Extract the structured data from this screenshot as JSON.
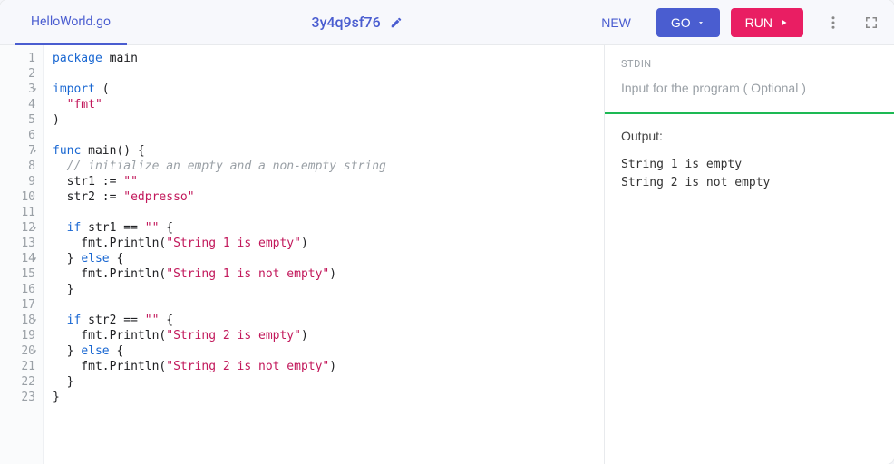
{
  "topbar": {
    "filename": "HelloWorld.go",
    "share_id": "3y4q9sf76",
    "new_label": "NEW",
    "lang_label": "GO",
    "run_label": "RUN"
  },
  "editor": {
    "lines": [
      {
        "n": 1,
        "fold": false,
        "html": "<span class='kw'>package</span> main"
      },
      {
        "n": 2,
        "fold": false,
        "html": ""
      },
      {
        "n": 3,
        "fold": true,
        "html": "<span class='kw'>import</span> ("
      },
      {
        "n": 4,
        "fold": false,
        "html": "  <span class='str'>\"fmt\"</span>"
      },
      {
        "n": 5,
        "fold": false,
        "html": ")"
      },
      {
        "n": 6,
        "fold": false,
        "html": ""
      },
      {
        "n": 7,
        "fold": true,
        "html": "<span class='kw'>func</span> <span class='fn'>main</span>() {"
      },
      {
        "n": 8,
        "fold": false,
        "html": "  <span class='com'>// initialize an empty and a non-empty string</span>",
        "hl": true
      },
      {
        "n": 9,
        "fold": false,
        "html": "  str1 := <span class='str'>\"\"</span>"
      },
      {
        "n": 10,
        "fold": false,
        "html": "  str2 := <span class='str'>\"edpresso\"</span>"
      },
      {
        "n": 11,
        "fold": false,
        "html": ""
      },
      {
        "n": 12,
        "fold": true,
        "html": "  <span class='kw'>if</span> str1 == <span class='str'>\"\"</span> {"
      },
      {
        "n": 13,
        "fold": false,
        "html": "    fmt.<span class='fn'>Println</span>(<span class='str'>\"String 1 is empty\"</span>)"
      },
      {
        "n": 14,
        "fold": true,
        "html": "  } <span class='kw'>else</span> {"
      },
      {
        "n": 15,
        "fold": false,
        "html": "    fmt.<span class='fn'>Println</span>(<span class='str'>\"String 1 is not empty\"</span>)"
      },
      {
        "n": 16,
        "fold": false,
        "html": "  }"
      },
      {
        "n": 17,
        "fold": false,
        "html": ""
      },
      {
        "n": 18,
        "fold": true,
        "html": "  <span class='kw'>if</span> str2 == <span class='str'>\"\"</span> {"
      },
      {
        "n": 19,
        "fold": false,
        "html": "    fmt.<span class='fn'>Println</span>(<span class='str'>\"String 2 is empty\"</span>)"
      },
      {
        "n": 20,
        "fold": true,
        "html": "  } <span class='kw'>else</span> {"
      },
      {
        "n": 21,
        "fold": false,
        "html": "    fmt.<span class='fn'>Println</span>(<span class='str'>\"String 2 is not empty\"</span>)"
      },
      {
        "n": 22,
        "fold": false,
        "html": "  }"
      },
      {
        "n": 23,
        "fold": false,
        "html": "}"
      }
    ]
  },
  "stdin": {
    "label": "STDIN",
    "placeholder": "Input for the program ( Optional )"
  },
  "output": {
    "label": "Output:",
    "lines": [
      "String 1 is empty",
      "String 2 is not empty"
    ]
  }
}
